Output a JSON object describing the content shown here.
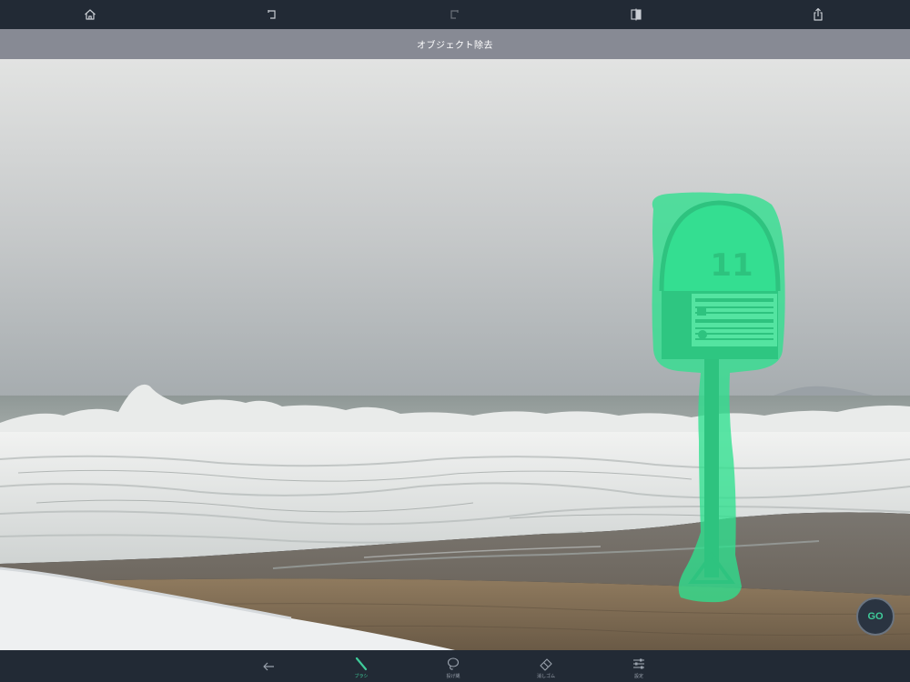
{
  "title": "オブジェクト除去",
  "topbar": {
    "icons": [
      "home-icon",
      "undo-icon",
      "redo-icon",
      "compare-icon",
      "share-icon"
    ]
  },
  "go_button": {
    "label": "GO"
  },
  "bottombar": {
    "items": [
      {
        "icon": "back-arrow-icon",
        "label": ""
      },
      {
        "icon": "brush-icon",
        "label": "ブラシ"
      },
      {
        "icon": "lasso-icon",
        "label": "投げ縄"
      },
      {
        "icon": "eraser-icon",
        "label": "消しゴム"
      },
      {
        "icon": "settings-sliders-icon",
        "label": "設定"
      }
    ]
  },
  "colors": {
    "accent": "#3fcb9a",
    "toolbar": "#222a35",
    "titlebar": "#878a94",
    "selection": "#2ee08e"
  },
  "photo": {
    "sign_number": "11"
  }
}
